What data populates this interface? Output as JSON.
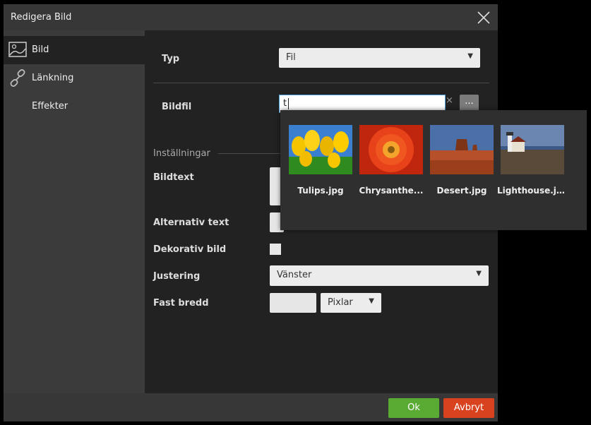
{
  "dialog": {
    "title": "Redigera Bild"
  },
  "sidebar": {
    "items": [
      {
        "label": "Bild"
      },
      {
        "label": "Länkning"
      },
      {
        "label": "Effekter"
      }
    ]
  },
  "form": {
    "typ_label": "Typ",
    "typ_value": "Fil",
    "bildfil_label": "Bildfil",
    "bildfil_value": "t",
    "clear_label": "×",
    "browse_label": "...",
    "section_label": "Inställningar",
    "bildtext_label": "Bildtext",
    "alt_label": "Alternativ text",
    "dekorativ_label": "Dekorativ bild",
    "justering_label": "Justering",
    "justering_value": "Vänster",
    "fast_bredd_label": "Fast bredd",
    "unit_value": "Pixlar"
  },
  "picker": {
    "files": [
      {
        "name": "Tulips.jpg"
      },
      {
        "name": "Chrysanthe..."
      },
      {
        "name": "Desert.jpg"
      },
      {
        "name": "Lighthouse.jpg"
      }
    ]
  },
  "footer": {
    "ok_label": "Ok",
    "cancel_label": "Avbryt"
  },
  "colors": {
    "ok": "#5aab34",
    "cancel": "#d9421e",
    "focus": "#4aa3df"
  }
}
